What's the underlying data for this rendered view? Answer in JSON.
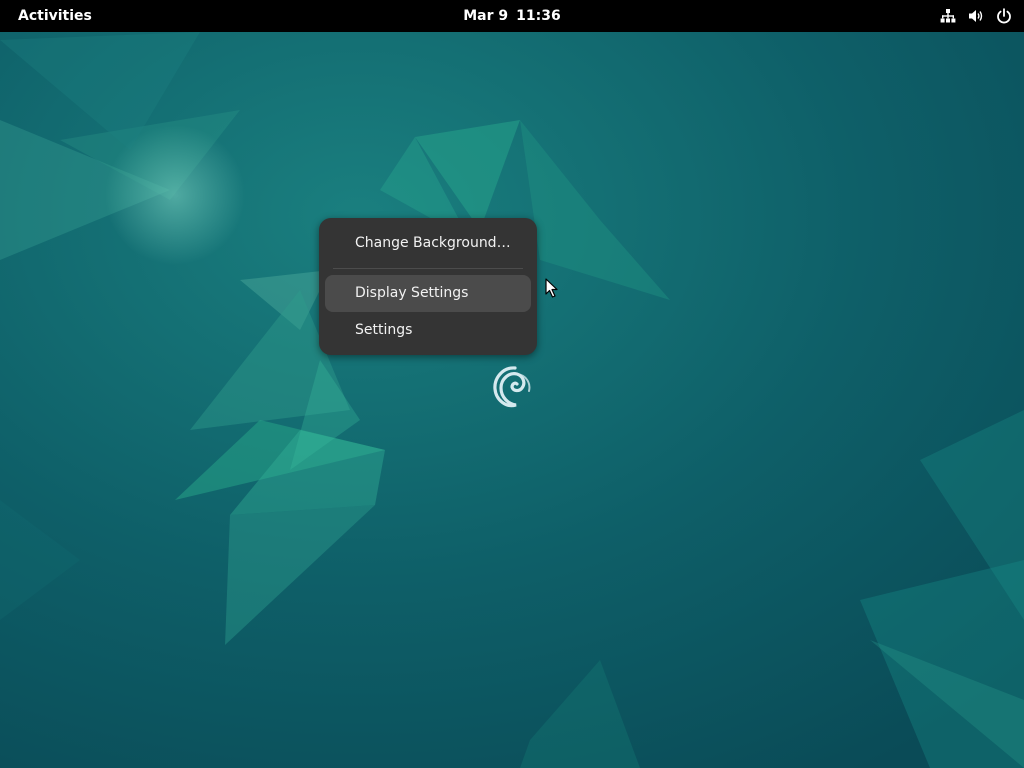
{
  "topbar": {
    "activities_label": "Activities",
    "date": "Mar 9",
    "time": "11:36",
    "tray_icons": [
      "network-wired-icon",
      "volume-icon",
      "power-icon"
    ]
  },
  "context_menu": {
    "items": [
      {
        "label": "Change Background…",
        "highlighted": false
      },
      {
        "label": "Display Settings",
        "highlighted": true
      },
      {
        "label": "Settings",
        "highlighted": false
      }
    ]
  },
  "desktop": {
    "logo": "debian-swirl-icon",
    "colors": {
      "background": "#0d5a63",
      "accent": "#1f9a86",
      "menu_background": "#343434",
      "menu_highlight": "#4b4b4b",
      "topbar": "#000000"
    }
  }
}
